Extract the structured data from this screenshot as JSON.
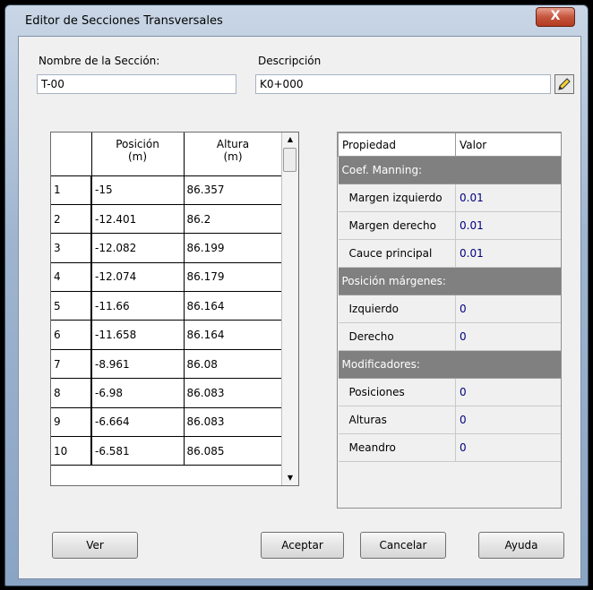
{
  "window": {
    "title": "Editor de Secciones Transversales",
    "close_glyph": "X"
  },
  "section": {
    "name_label": "Nombre de la Sección:",
    "name_value": "T-00",
    "desc_label": "Descripción",
    "desc_value": "K0+000",
    "edit_icon": "pencil-icon"
  },
  "grid": {
    "headers": {
      "pos_line1": "Posición",
      "pos_line2": "(m)",
      "alt_line1": "Altura",
      "alt_line2": "(m)"
    },
    "rows": [
      {
        "n": "1",
        "pos": "-15",
        "alt": "86.357"
      },
      {
        "n": "2",
        "pos": "-12.401",
        "alt": "86.2"
      },
      {
        "n": "3",
        "pos": "-12.082",
        "alt": "86.199"
      },
      {
        "n": "4",
        "pos": "-12.074",
        "alt": "86.179"
      },
      {
        "n": "5",
        "pos": "-11.66",
        "alt": "86.164"
      },
      {
        "n": "6",
        "pos": "-11.658",
        "alt": "86.164"
      },
      {
        "n": "7",
        "pos": "-8.961",
        "alt": "86.08"
      },
      {
        "n": "8",
        "pos": "-6.98",
        "alt": "86.083"
      },
      {
        "n": "9",
        "pos": "-6.664",
        "alt": "86.083"
      },
      {
        "n": "10",
        "pos": "-6.581",
        "alt": "86.085"
      }
    ]
  },
  "props": {
    "header": {
      "prop": "Propiedad",
      "value": "Valor"
    },
    "groups": [
      {
        "category": "Coef. Manning:",
        "items": [
          {
            "k": "Margen izquierdo",
            "v": "0.01"
          },
          {
            "k": "Margen derecho",
            "v": "0.01"
          },
          {
            "k": "Cauce principal",
            "v": "0.01"
          }
        ]
      },
      {
        "category": "Posición márgenes:",
        "items": [
          {
            "k": "Izquierdo",
            "v": "0"
          },
          {
            "k": "Derecho",
            "v": "0"
          }
        ]
      },
      {
        "category": "Modificadores:",
        "items": [
          {
            "k": "Posiciones",
            "v": "0"
          },
          {
            "k": "Alturas",
            "v": "0"
          },
          {
            "k": "Meandro",
            "v": "0"
          }
        ]
      }
    ]
  },
  "buttons": {
    "ver": "Ver",
    "aceptar": "Aceptar",
    "cancelar": "Cancelar",
    "ayuda": "Ayuda"
  }
}
